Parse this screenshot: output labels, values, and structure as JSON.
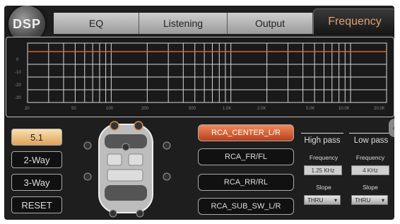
{
  "logo": {
    "text": "DSP"
  },
  "tabs": [
    {
      "label": "EQ"
    },
    {
      "label": "Listening"
    },
    {
      "label": "Output"
    },
    {
      "label": "Frequency",
      "active": true
    }
  ],
  "graph": {
    "y_ticks": [
      "0",
      "-10",
      "-20",
      "-30"
    ],
    "x_ticks": [
      "20",
      "50",
      "100",
      "200",
      "500",
      "1.0K",
      "2.0K",
      "5.0K",
      "10.0K",
      "20.0K"
    ],
    "line_color": "#e0602a",
    "level_db": 0
  },
  "presets": [
    {
      "label": "5.1",
      "active": true
    },
    {
      "label": "2-Way"
    },
    {
      "label": "3-Way"
    },
    {
      "label": "RESET"
    }
  ],
  "channels": [
    {
      "label": "RCA_CENTER_L/R",
      "active": true
    },
    {
      "label": "RCA_FR/FL"
    },
    {
      "label": "RCA_RR/RL"
    },
    {
      "label": "RCA_SUB_SW_L/R"
    }
  ],
  "filters": {
    "high_pass": {
      "title": "High pass",
      "freq_label": "Frequency",
      "freq_value": "1.25 KHz",
      "slope_label": "Slope",
      "slope_value": "THRU"
    },
    "low_pass": {
      "title": "Low pass",
      "freq_label": "Frequency",
      "freq_value": "4 KHz",
      "slope_label": "Slope",
      "slope_value": "THRU"
    }
  },
  "colors": {
    "accent": "#e0a070",
    "active_channel": "#d0582a",
    "active_preset": "#ebb870"
  }
}
